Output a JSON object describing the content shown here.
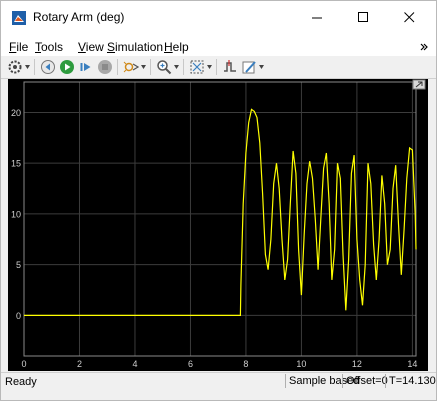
{
  "window": {
    "title": "Rotary Arm (deg)",
    "controls": [
      "minimize",
      "maximize",
      "close"
    ]
  },
  "menu": {
    "items": [
      "File",
      "Tools",
      "View",
      "Simulation",
      "Help"
    ]
  },
  "toolbar": {
    "icons": [
      "settings-icon",
      "step-back-icon",
      "run-icon",
      "step-forward-icon",
      "stop-icon",
      "highlight-icon",
      "zoom-icon",
      "autoscale-icon",
      "triggers-icon",
      "style-icon"
    ]
  },
  "status": {
    "ready": "Ready",
    "mode": "Sample based",
    "offset": "Offset=0",
    "time": "T=14.130"
  },
  "colors": {
    "signal": "#ffff00",
    "plot_background": "#000000",
    "grid": "#3c3c3c",
    "tick_label": "#cfcfcf"
  },
  "chart_data": {
    "type": "line",
    "title": "",
    "xlabel": "",
    "ylabel": "",
    "xlim": [
      0,
      14.13
    ],
    "ylim": [
      -4,
      23
    ],
    "xticks": [
      0,
      2,
      4,
      6,
      8,
      10,
      12,
      14
    ],
    "yticks": [
      0,
      5,
      10,
      15,
      20
    ],
    "grid": true,
    "legend": "none",
    "series": [
      {
        "color": "#ffff00",
        "x": [
          0,
          7.8,
          7.82,
          7.9,
          8.0,
          8.1,
          8.2,
          8.3,
          8.4,
          8.5,
          8.6,
          8.7,
          8.8,
          8.9,
          9.0,
          9.1,
          9.2,
          9.3,
          9.4,
          9.5,
          9.6,
          9.7,
          9.8,
          9.9,
          10.0,
          10.1,
          10.2,
          10.3,
          10.4,
          10.5,
          10.6,
          10.7,
          10.8,
          10.9,
          11.0,
          11.1,
          11.2,
          11.3,
          11.4,
          11.5,
          11.6,
          11.7,
          11.8,
          11.9,
          12.0,
          12.1,
          12.2,
          12.3,
          12.4,
          12.5,
          12.6,
          12.7,
          12.8,
          12.9,
          13.0,
          13.1,
          13.2,
          13.3,
          13.4,
          13.5,
          13.6,
          13.7,
          13.8,
          13.9,
          14.0,
          14.1,
          14.13
        ],
        "y": [
          0,
          0,
          3,
          11,
          16,
          19,
          20.3,
          20.1,
          19.5,
          17,
          12,
          6,
          4.5,
          7.5,
          13,
          15,
          12.5,
          7.5,
          3.5,
          5.5,
          11,
          16.2,
          14,
          6.5,
          2,
          8,
          13,
          15.2,
          13.5,
          9.5,
          4.5,
          9.5,
          14.5,
          16,
          11,
          3.5,
          6.5,
          15,
          13.5,
          6,
          0.5,
          5.5,
          14,
          15.8,
          7.5,
          3.5,
          1,
          5,
          15,
          13,
          7,
          3.5,
          7.5,
          13.8,
          11,
          5,
          6.5,
          12.5,
          14.8,
          9,
          4,
          8.5,
          13.5,
          16.5,
          16.3,
          10,
          6.5
        ]
      }
    ]
  }
}
